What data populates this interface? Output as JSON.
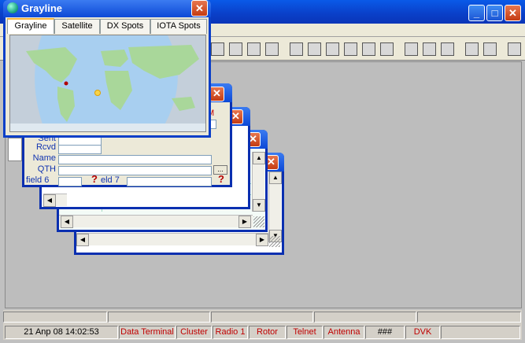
{
  "grayline": {
    "title": "Grayline",
    "close": "✕",
    "tabs": [
      {
        "label": "Grayline",
        "active": true
      },
      {
        "label": "Satellite",
        "active": false
      },
      {
        "label": "DX Spots",
        "active": false
      },
      {
        "label": "IOTA Spots",
        "active": false
      }
    ]
  },
  "main_window": {
    "minimize": "_",
    "maximize": "□",
    "close": "✕"
  },
  "child_close": "✕",
  "qso_form": {
    "fields": [
      {
        "label": "Sent"
      },
      {
        "label": "Rcvd"
      },
      {
        "label": "Name"
      },
      {
        "label": "QTH"
      }
    ],
    "field6_label": "field 6",
    "field7_label": "eld 7",
    "qth_browse": "...",
    "qmark": "?",
    "partial_label": "M"
  },
  "statusbar": {
    "datetime": "21 Anp 08  14:02:53",
    "items": [
      "Data Terminal",
      "Cluster",
      "Radio 1",
      "Rotor",
      "Telnet",
      "Antenna",
      "###",
      "DVK"
    ]
  },
  "colors": {
    "title_blue": "#0a3fc8",
    "status_red": "#c00000",
    "label_blue": "#1033b0"
  }
}
